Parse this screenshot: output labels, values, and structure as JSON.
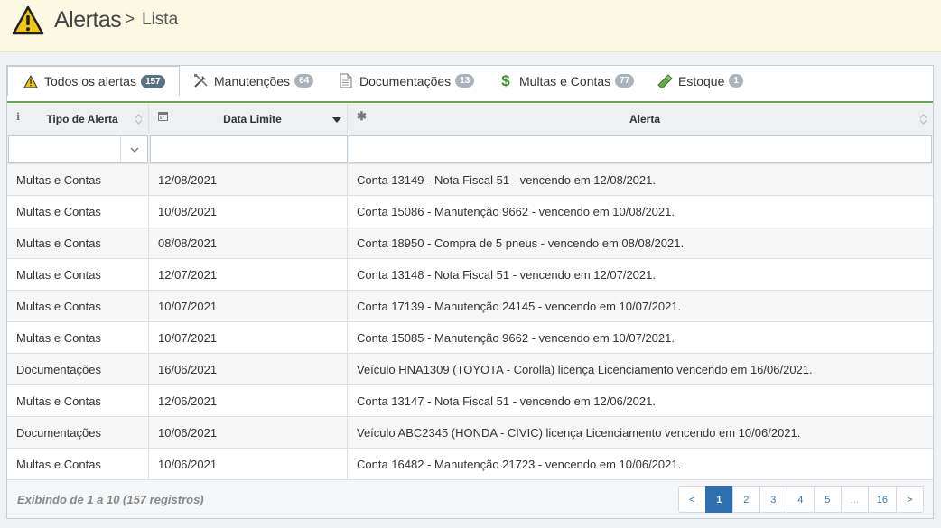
{
  "header": {
    "title": "Alertas",
    "separator": ">",
    "breadcrumb": "Lista"
  },
  "tabs": [
    {
      "label": "Todos os alertas",
      "count": "157",
      "icon": "warning-icon",
      "active": true
    },
    {
      "label": "Manutenções",
      "count": "64",
      "icon": "tools-icon",
      "active": false
    },
    {
      "label": "Documentações",
      "count": "13",
      "icon": "document-icon",
      "active": false
    },
    {
      "label": "Multas e Contas",
      "count": "77",
      "icon": "dollar-icon",
      "active": false
    },
    {
      "label": "Estoque",
      "count": "1",
      "icon": "stock-icon",
      "active": false
    }
  ],
  "table": {
    "columns": [
      "Tipo de Alerta",
      "Data Limite",
      "Alerta"
    ],
    "column_icons": [
      "info-icon",
      "calendar-icon",
      "asterisk-icon"
    ],
    "sorted_column": "Data Limite",
    "sort_direction": "descending",
    "rows": [
      [
        "Multas e Contas",
        "12/08/2021",
        "Conta 13149 - Nota Fiscal 51 - vencendo em 12/08/2021."
      ],
      [
        "Multas e Contas",
        "10/08/2021",
        "Conta 15086 - Manutenção 9662 - vencendo em 10/08/2021."
      ],
      [
        "Multas e Contas",
        "08/08/2021",
        "Conta 18950 - Compra de 5 pneus - vencendo em 08/08/2021."
      ],
      [
        "Multas e Contas",
        "12/07/2021",
        "Conta 13148 - Nota Fiscal 51 - vencendo em 12/07/2021."
      ],
      [
        "Multas e Contas",
        "10/07/2021",
        "Conta 17139 - Manutenção 24145 - vencendo em 10/07/2021."
      ],
      [
        "Multas e Contas",
        "10/07/2021",
        "Conta 15085 - Manutenção 9662 - vencendo em 10/07/2021."
      ],
      [
        "Documentações",
        "16/06/2021",
        "Veículo HNA1309 (TOYOTA - Corolla) licença Licenciamento vencendo em 16/06/2021."
      ],
      [
        "Multas e Contas",
        "12/06/2021",
        "Conta 13147 - Nota Fiscal 51 - vencendo em 12/06/2021."
      ],
      [
        "Documentações",
        "10/06/2021",
        "Veículo ABC2345 (HONDA - CIVIC) licença Licenciamento vencendo em 10/06/2021."
      ],
      [
        "Multas e Contas",
        "10/06/2021",
        "Conta 16482 - Manutenção 21723 - vencendo em 10/06/2021."
      ]
    ]
  },
  "footer": {
    "info": "Exibindo de 1 a 10 (157 registros)"
  },
  "pagination": {
    "prev": "<",
    "pages": [
      "1",
      "2",
      "3",
      "4",
      "5",
      "...",
      "16"
    ],
    "current": "1",
    "next": ">"
  },
  "colors": {
    "header_bg": "#fcf8e3",
    "active_page": "#2f6fad",
    "tab_underline": "#6aa84f",
    "warning": "#f0c419"
  }
}
